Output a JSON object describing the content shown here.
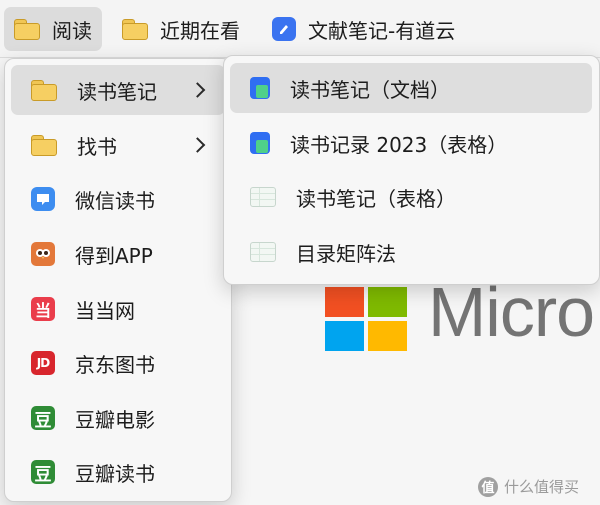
{
  "bookmark_bar": {
    "items": [
      {
        "label": "阅读",
        "icon": "folder-icon",
        "active": true
      },
      {
        "label": "近期在看",
        "icon": "folder-icon"
      },
      {
        "label": "文献笔记-有道云",
        "icon": "youdao-note-icon"
      }
    ]
  },
  "main_menu": {
    "items": [
      {
        "label": "读书笔记",
        "icon": "folder-icon",
        "submenu": true,
        "highlighted": true
      },
      {
        "label": "找书",
        "icon": "folder-icon",
        "submenu": true
      },
      {
        "label": "微信读书",
        "icon": "wechat-reading-icon"
      },
      {
        "label": "得到APP",
        "icon": "dedao-owl-icon"
      },
      {
        "label": "当当网",
        "icon": "dangdang-icon",
        "glyph": "当"
      },
      {
        "label": "京东图书",
        "icon": "jd-icon",
        "glyph": "JD"
      },
      {
        "label": "豆瓣电影",
        "icon": "douban-icon",
        "glyph": "豆"
      },
      {
        "label": "豆瓣读书",
        "icon": "douban-icon",
        "glyph": "豆"
      }
    ]
  },
  "submenu": {
    "items": [
      {
        "label": "读书笔记（文档）",
        "icon": "doc-icon",
        "highlighted": true
      },
      {
        "label": "读书记录 2023（表格）",
        "icon": "doc-icon"
      },
      {
        "label": "读书笔记（表格）",
        "icon": "sheet-icon"
      },
      {
        "label": "目录矩阵法",
        "icon": "sheet-icon"
      }
    ]
  },
  "background": {
    "logo_text": "Micro",
    "logo_colors": [
      "#f25022",
      "#7fba00",
      "#00a4ef",
      "#ffb900"
    ]
  },
  "watermark": {
    "glyph": "值",
    "text": "什么值得买"
  }
}
